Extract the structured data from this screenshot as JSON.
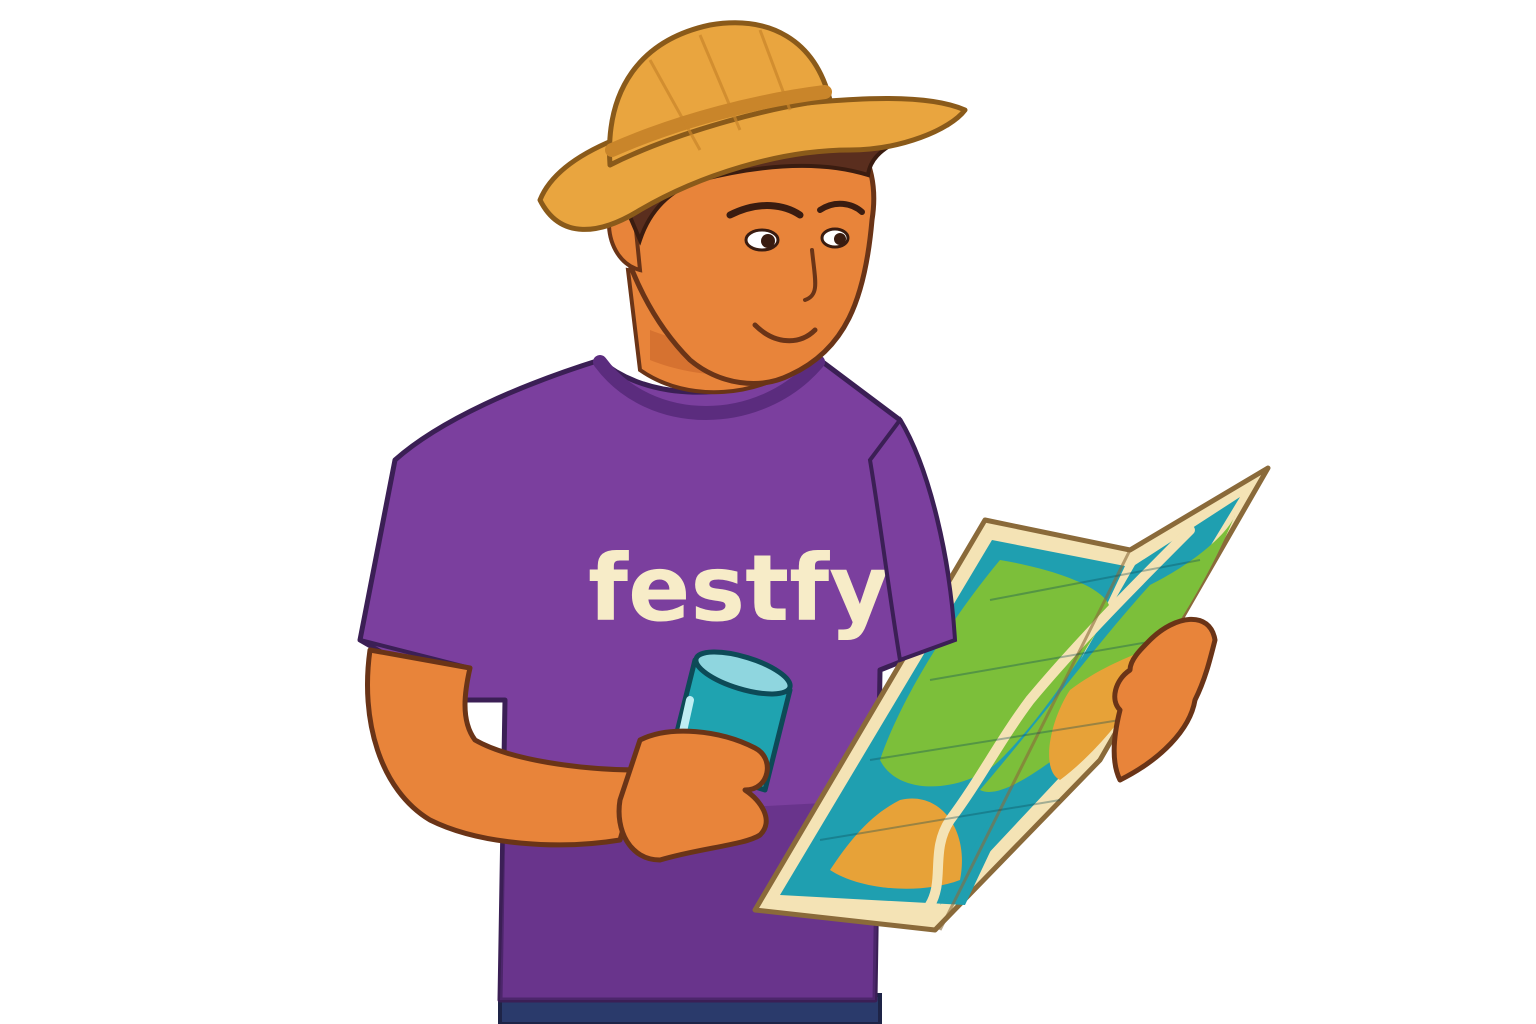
{
  "shirt": {
    "logo_text": "festfy"
  },
  "colors": {
    "background": "#ffffff",
    "skin": "#e8843a",
    "skin_shadow": "#c9662a",
    "outline": "#6a3417",
    "shirt": "#7b3f9e",
    "shirt_shadow": "#5b2c7e",
    "shirt_text": "#f7ecc8",
    "hat": "#e9a53f",
    "hat_shadow": "#c9852a",
    "hair": "#5a2e1e",
    "can": "#1fa3b0",
    "map_border": "#f4e3b5",
    "map_water": "#1f9fb0",
    "map_land": "#7cbf3a",
    "map_sand": "#e7a238",
    "jeans": "#2a3a6b"
  },
  "icons": {
    "can": "drink-can-icon",
    "map": "folded-map-icon",
    "hat": "straw-hat-icon"
  }
}
